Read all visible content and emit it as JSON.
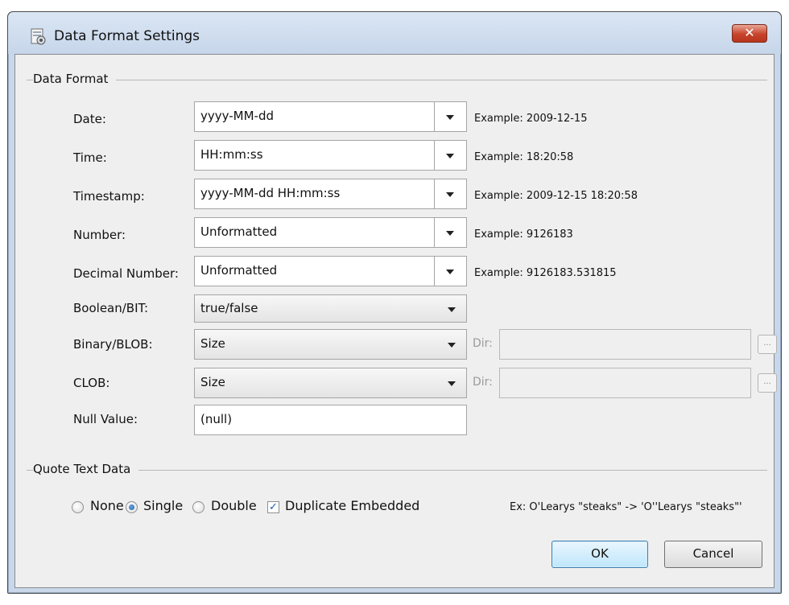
{
  "window": {
    "title": "Data Format Settings",
    "close_label": "✕"
  },
  "data_format": {
    "group_label": "Data Format",
    "rows": [
      {
        "label": "Date:",
        "value": "yyyy-MM-dd",
        "example": "Example: 2009-12-15"
      },
      {
        "label": "Time:",
        "value": "HH:mm:ss",
        "example": "Example: 18:20:58"
      },
      {
        "label": "Timestamp:",
        "value": "yyyy-MM-dd HH:mm:ss",
        "example": "Example: 2009-12-15 18:20:58"
      },
      {
        "label": "Number:",
        "value": "Unformatted",
        "example": "Example: 9126183"
      },
      {
        "label": "Decimal Number:",
        "value": "Unformatted",
        "example": "Example: 9126183.531815"
      }
    ],
    "boolean": {
      "label": "Boolean/BIT:",
      "value": "true/false"
    },
    "binary": {
      "label": "Binary/BLOB:",
      "value": "Size",
      "dir_label": "Dir:",
      "dir_value": "",
      "browse_label": "..."
    },
    "clob": {
      "label": "CLOB:",
      "value": "Size",
      "dir_label": "Dir:",
      "dir_value": "",
      "browse_label": "..."
    },
    "null_value": {
      "label": "Null Value:",
      "value": "(null)"
    }
  },
  "quote_text": {
    "group_label": "Quote Text Data",
    "options": [
      {
        "label": "None",
        "selected": false
      },
      {
        "label": "Single",
        "selected": true
      },
      {
        "label": "Double",
        "selected": false
      }
    ],
    "duplicate_embedded": {
      "label": "Duplicate Embedded",
      "checked": true
    },
    "example": "Ex: O'Learys \"steaks\" -> 'O''Learys \"steaks\"'"
  },
  "buttons": {
    "ok": "OK",
    "cancel": "Cancel"
  }
}
